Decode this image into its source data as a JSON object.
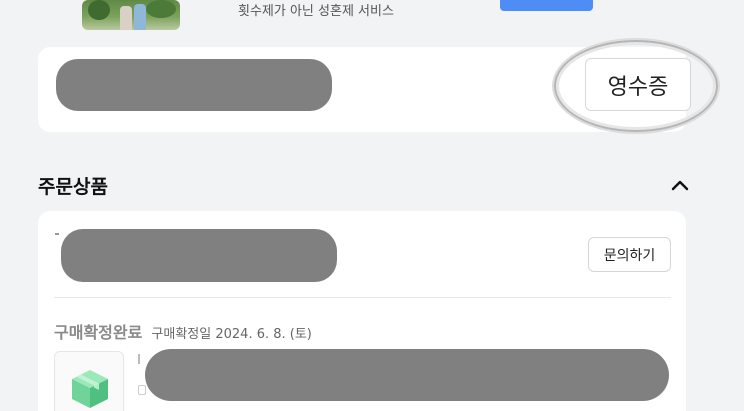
{
  "top_banner": {
    "service_text": "횟수제가 아닌 성혼제 서비스",
    "thumbnail_icon": "couple-photo"
  },
  "receipt": {
    "button_label": "영수증"
  },
  "order_section": {
    "title": "주문상품",
    "toggle_icon": "chevron-up-icon",
    "inquiry_label": "문의하기",
    "status": "구매확정완료",
    "status_detail": "구매확정일 2024. 6. 8. (토)",
    "product_icon": "box-icon",
    "cut_off_text": "…"
  },
  "colors": {
    "background": "#f2f3f5",
    "card": "#ffffff",
    "redaction": "#808080",
    "accent_blue": "#4e8cf6",
    "box_green": "#6fd39a"
  }
}
